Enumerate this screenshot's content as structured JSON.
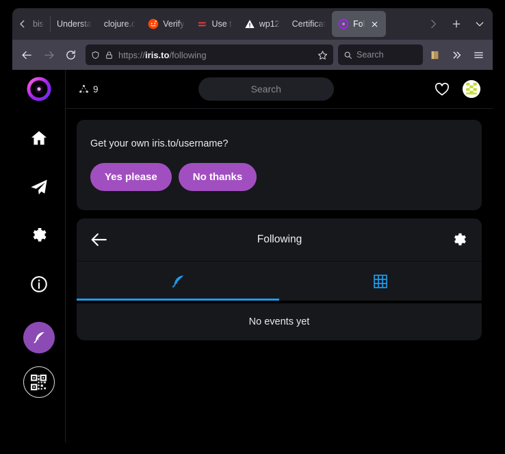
{
  "browser": {
    "tab_scroll_left_icon": "chevron-left-icon",
    "tab_scroll_right_icon": "chevron-right-icon",
    "new_tab_icon": "plus-icon",
    "list_all_tabs_icon": "chevron-down-icon",
    "tabs": [
      {
        "title": "bis",
        "favicon": "none",
        "active": false,
        "partial": true
      },
      {
        "title": "Understa",
        "favicon": "none",
        "active": false,
        "partial": false
      },
      {
        "title": "clojure.c",
        "favicon": "none",
        "active": false,
        "partial": false
      },
      {
        "title": "Verify",
        "favicon": "reddit-icon",
        "active": false,
        "partial": false
      },
      {
        "title": "Use t",
        "favicon": "red-lines-icon",
        "active": false,
        "partial": false
      },
      {
        "title": "wp12",
        "favicon": "warning-triangle-icon",
        "active": false,
        "partial": false
      },
      {
        "title": "Certificat",
        "favicon": "none",
        "active": false,
        "partial": false
      },
      {
        "title": "Fol",
        "favicon": "iris-icon",
        "active": true,
        "partial": false
      }
    ],
    "toolbar": {
      "back_icon": "arrow-left-icon",
      "forward_icon": "arrow-right-icon",
      "reload_icon": "reload-icon",
      "shield_icon": "shield-icon",
      "lock_icon": "padlock-icon",
      "url_prefix": "https://",
      "url_host": "iris.to",
      "url_path": "/following",
      "bookmark_star_icon": "star-icon",
      "search_icon": "search-icon",
      "search_placeholder": "Search",
      "bookmarks_icon": "bookmarks-icon",
      "overflow_icon": "double-chevron-right-icon",
      "menu_icon": "hamburger-menu-icon"
    }
  },
  "app": {
    "sidebar": {
      "logo": "iris-logo-icon",
      "items": [
        {
          "icon": "home-icon",
          "name": "home"
        },
        {
          "icon": "paper-plane-icon",
          "name": "messages"
        },
        {
          "icon": "gear-icon",
          "name": "settings"
        },
        {
          "icon": "info-circle-icon",
          "name": "about"
        }
      ],
      "compose_icon": "feather-icon",
      "qr_icon": "qr-code-icon"
    },
    "header": {
      "relay_icon": "relay-network-icon",
      "relay_count": "9",
      "search_placeholder": "Search",
      "heart_icon": "heart-icon",
      "avatar": "user-avatar"
    },
    "promo": {
      "text": "Get your own iris.to/username?",
      "yes_label": "Yes please",
      "no_label": "No thanks"
    },
    "feed": {
      "back_icon": "arrow-left-icon",
      "title": "Following",
      "settings_icon": "gear-icon",
      "tabs": [
        {
          "icon": "feather-icon",
          "name": "posts",
          "active": true
        },
        {
          "icon": "grid-icon",
          "name": "media",
          "active": false
        }
      ],
      "empty_message": "No events yet"
    }
  },
  "colors": {
    "accent_purple": "#a14fc0",
    "accent_blue": "#1d9bf0",
    "card_bg": "#16181c",
    "page_bg": "#000000",
    "chrome_bg": "#2b2a33",
    "toolbar_bg": "#42414d",
    "avatar_green": "#c5dc2c"
  }
}
